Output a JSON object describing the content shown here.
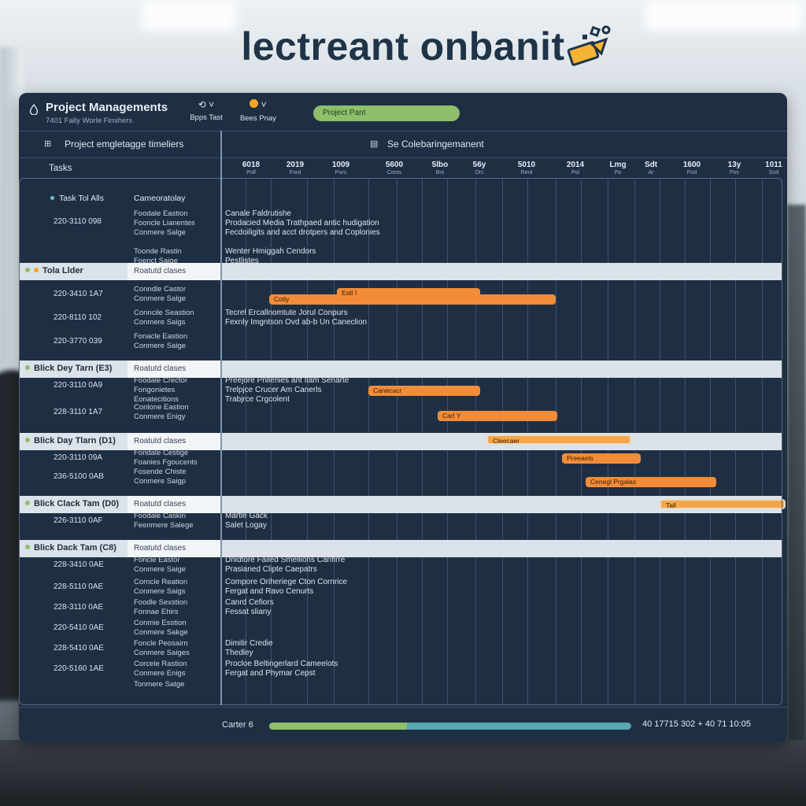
{
  "headline": "lectreant onbanit",
  "app": {
    "title": "Project Managements",
    "subtitle": "7401 Fally Worle Finshers"
  },
  "toolbar": {
    "btn1_label": "Bpps Tast",
    "btn2_label": "Bees Pnay",
    "phase_label": "Project Pant"
  },
  "left_header": "Project emgletagge timeliers",
  "right_header": "Se Colebaringemanent",
  "tasks_label": "Tasks",
  "timeline_heads": [
    {
      "top": "6018",
      "sub": "Poll"
    },
    {
      "top": "2019",
      "sub": "Ford"
    },
    {
      "top": "1009",
      "sub": "Purs"
    },
    {
      "top": "5600",
      "sub": "Conts"
    },
    {
      "top": "5lbo",
      "sub": "Bnt"
    },
    {
      "top": "56y",
      "sub": "Orc"
    },
    {
      "top": "5010",
      "sub": "Rerd"
    },
    {
      "top": "2014",
      "sub": "Pol"
    },
    {
      "top": "Lmg",
      "sub": "Po"
    },
    {
      "top": "Sdt",
      "sub": "Ar"
    },
    {
      "top": "1600",
      "sub": "Pod"
    },
    {
      "top": "13y",
      "sub": "Pos"
    },
    {
      "top": "1011",
      "sub": "Sod"
    }
  ],
  "top_task": {
    "label": "Task Tol Alls",
    "category": "Cameoratolay",
    "id": "220-3110 098",
    "assignees": [
      "Foodale Eastion",
      "Fooncle Lianentes",
      "Conmere Salge",
      "",
      "Toonde Rastin",
      "Foenct Saige"
    ],
    "desc": [
      "Canale Faldrutishe",
      "Prodacied Media Trathpaed antic hudigation",
      "Fecdoiligits and acct drotpers and Coplonies",
      "",
      "Wenter Hmiggah Cendors",
      "Pestlistes"
    ]
  },
  "sections": [
    {
      "label": "Tola Llder",
      "status": "Roatutd clases",
      "tasks": [
        {
          "id": "220-3410 1A7",
          "assignees": [
            "Conndle Castor",
            "Conmere Salge"
          ],
          "desc": []
        },
        {
          "id": "220-8110 102",
          "assignees": [
            "Conncile Seastion",
            "Conmere Saigs"
          ],
          "desc": [
            "Tecrel Ercallnomtute Jorul Conpurs",
            "Fexnly Imgntson Ovd ab-b Un Caneclion"
          ]
        },
        {
          "id": "220-3770 039",
          "assignees": [
            "Fonacle Eastion",
            "Conmere Saige"
          ],
          "desc": []
        }
      ]
    },
    {
      "label": "Blick Dey Tarn (E3)",
      "status": "Roatutd clases",
      "tasks": [
        {
          "id": "220-3110 0A9",
          "assignees": [
            "Foodale Crector",
            "Fongonietes",
            "Eonatecitions"
          ],
          "desc": [
            "Preejore Pnllenies ant Ilam Senarte",
            "Trelpjce Crucer Am Canerls",
            "Trabjrce Crgcolent"
          ]
        },
        {
          "id": "228-3110 1A7",
          "assignees": [
            "Conlone Eastion",
            "Conmere Enigy"
          ],
          "desc": []
        }
      ]
    },
    {
      "label": "Blick Day Tlarn (D1)",
      "status": "Roatutd clases",
      "tasks": [
        {
          "id": "220-3110 09A",
          "assignees": [
            "Fondale Cestige",
            "Foanies Fgoucents"
          ],
          "desc": []
        },
        {
          "id": "236-5100 0AB",
          "assignees": [
            "Fosende Chiste",
            "Conmere Saigp"
          ],
          "desc": []
        }
      ]
    },
    {
      "label": "Blick Clack Tam (D0)",
      "status": "Roatutd clases",
      "tasks": [
        {
          "id": "226-3110 0AF",
          "assignees": [
            "Foodale Caskin",
            "Feenmere Salege"
          ],
          "desc": [
            "Martle Gack",
            "Salet Logay"
          ]
        }
      ]
    },
    {
      "label": "Blick Dack Tam (C8)",
      "status": "Roatutd clases",
      "tasks": [
        {
          "id": "228-3410 0AE",
          "assignees": [
            "Foncle Eastor",
            "Conmere Saige"
          ],
          "desc": [
            "Dnldtore Failed Smellions Canfirre",
            "Prasianed Clipte Caepatrs"
          ]
        },
        {
          "id": "228-5110 0AE",
          "assignees": [
            "Corncle Reation",
            "Conmere Saigs"
          ],
          "desc": [
            "Compore Oriheriege Cton Cornrice",
            "Fergat and Ravo Cenurts"
          ]
        },
        {
          "id": "228-3110 0AE",
          "assignees": [
            "Foodle Sexstion",
            "Fonnae Ehirs"
          ],
          "desc": [
            "Canrd Cefiors",
            "Fessat sliany"
          ]
        },
        {
          "id": "220-5410 0AE",
          "assignees": [
            "Conmie Esstion",
            "Conmere Sakge"
          ],
          "desc": []
        },
        {
          "id": "228-5410 0AE",
          "assignees": [
            "Foncle Peosairn",
            "Conmere Saiges"
          ],
          "desc": [
            "Dimitir Credie",
            "Thedley"
          ]
        },
        {
          "id": "220-5160 1AE",
          "assignees": [
            "Corcele Rastion",
            "Conmere Enigs"
          ],
          "desc": [
            "Procloe Beltingerlard Cameelots",
            "Fergat and Phymar Cepst"
          ]
        },
        {
          "id": "",
          "assignees": [
            "Tonmere Satge"
          ],
          "desc": []
        }
      ]
    }
  ],
  "bars": [
    {
      "label": "Cotly",
      "style": "solid"
    },
    {
      "label": "Eatl I",
      "style": "solid"
    },
    {
      "label": "Canecacr",
      "style": "solid"
    },
    {
      "label": "Carl Y",
      "style": "solid"
    },
    {
      "label": "Cleecaer",
      "style": "outlined"
    },
    {
      "label": "Preeaets",
      "style": "solid"
    },
    {
      "label": "Cenegl Prgalas",
      "style": "solid"
    },
    {
      "label": "Tall",
      "style": "outlined"
    }
  ],
  "footer": {
    "label": "Carter 6",
    "progress": 0.38,
    "stamp": "40 17715 302  + 40 71 10:05"
  },
  "colors": {
    "panel": "#1e2f44",
    "bar": "#f28c38",
    "accent_green": "#8fbf6a",
    "accent_teal": "#66b9c2"
  }
}
